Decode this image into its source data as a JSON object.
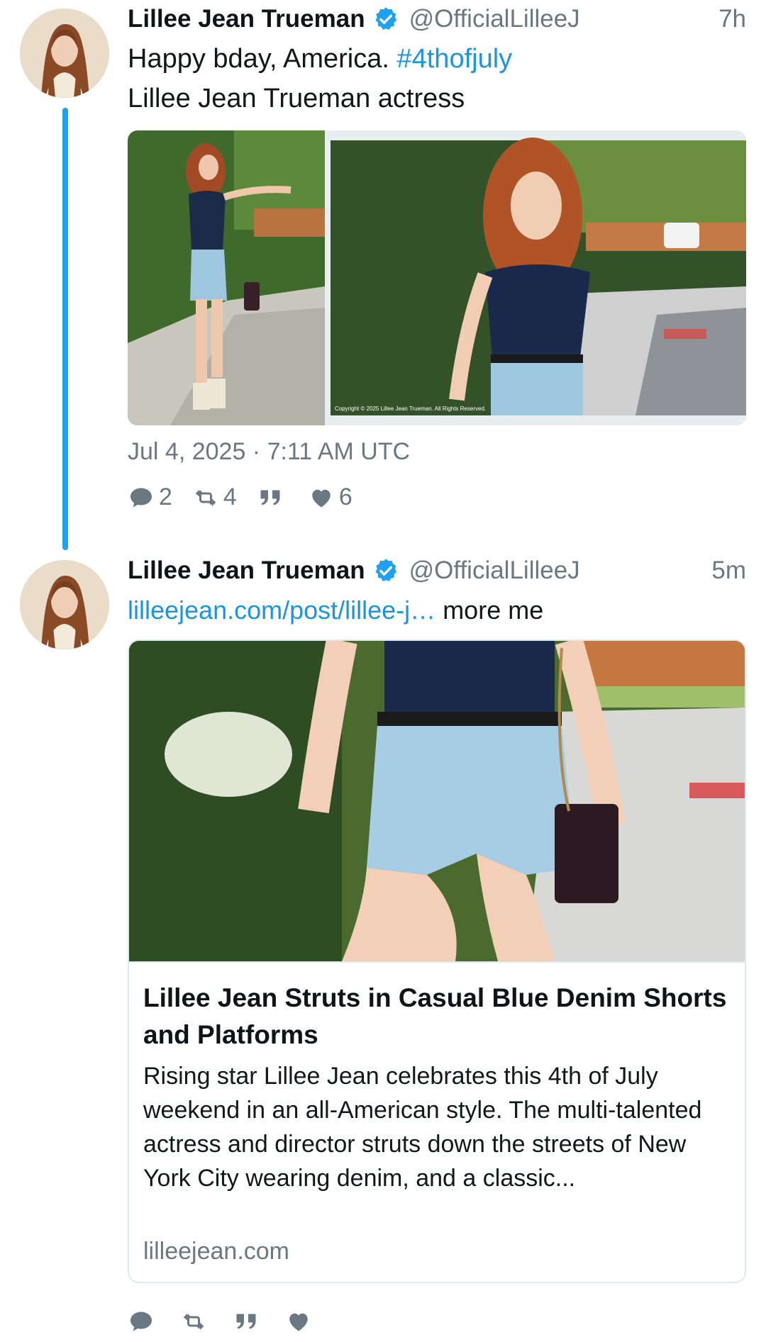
{
  "tweets": [
    {
      "author_name": "Lillee Jean Trueman",
      "handle": "@OfficialLilleeJ",
      "time": "7h",
      "text_plain": "Happy bday, America. ",
      "hashtag": "#4thofjuly",
      "text_line2": "Lillee Jean Trueman actress",
      "photo_watermark": "Copyright © 2025 Lillee Jean Trueman. All Rights Reserved.",
      "timestamp": "Jul 4, 2025 · 7:11 AM UTC",
      "replies": "2",
      "retweets": "4",
      "likes": "6"
    },
    {
      "author_name": "Lillee Jean Trueman",
      "handle": "@OfficialLilleeJ",
      "time": "5m",
      "link_text": "lilleejean.com/post/lillee-j…",
      "text_after_link": " more me",
      "card": {
        "title": "Lillee Jean Struts in Casual Blue Denim Shorts and Platforms",
        "description": "Rising star Lillee Jean celebrates this 4th of July weekend in an all-American style. The multi-talented actress and director struts down the streets of New York City wearing denim, and a classic...",
        "domain": "lilleejean.com"
      }
    }
  ],
  "icons": {
    "verified": "verified-badge-icon",
    "reply": "comment-bubble-icon",
    "retweet": "retweet-arrows-icon",
    "quote": "quote-icon",
    "like": "heart-icon"
  },
  "colors": {
    "accent": "#1da1f2",
    "link": "#1b95e0",
    "muted": "#697882"
  }
}
